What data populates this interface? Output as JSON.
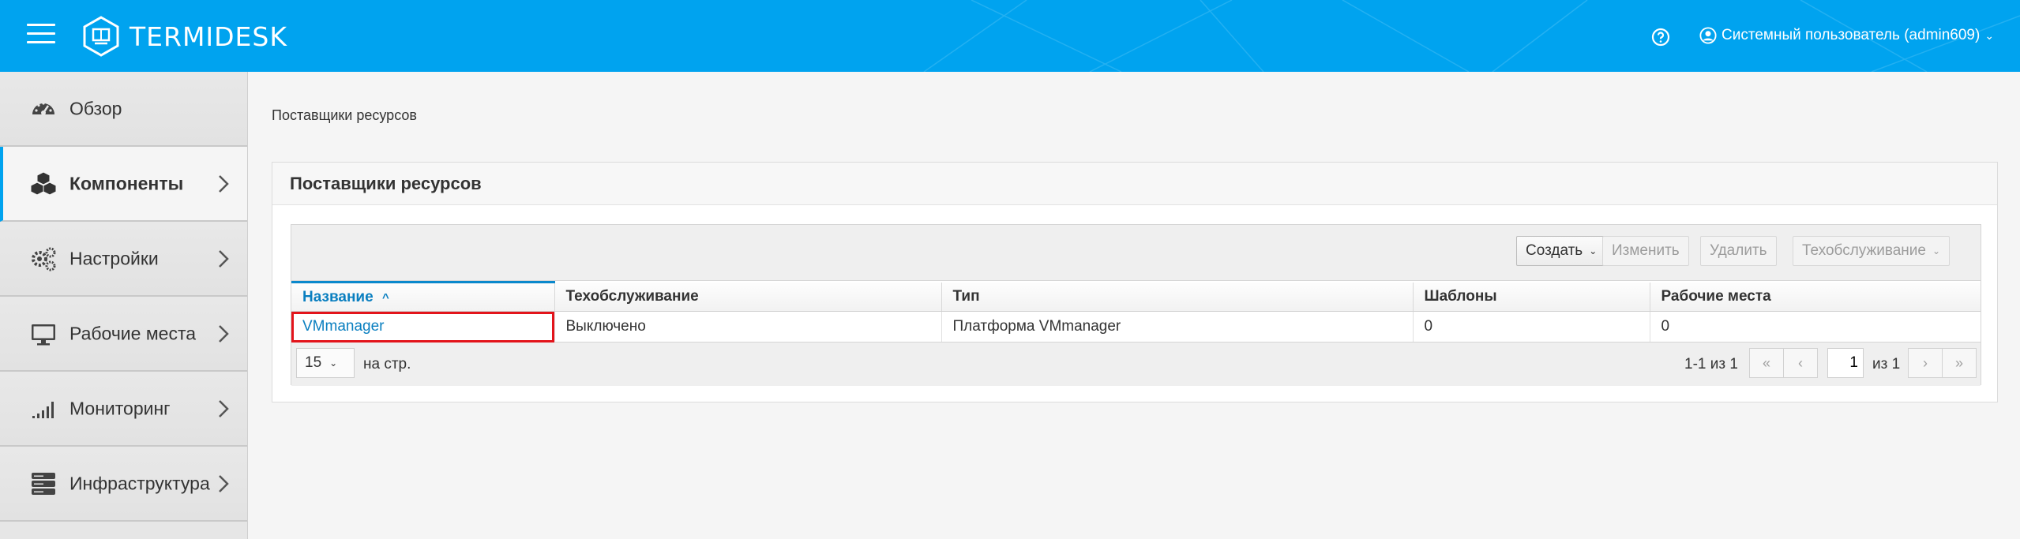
{
  "header": {
    "logo_text": "TERMIDESK",
    "user_label": "Системный пользователь (admin609)",
    "help_icon": "question-circle-icon",
    "user_icon": "user-circle-icon"
  },
  "colors": {
    "header_bg": "#00a3ef",
    "accent": "#0a7fc0",
    "highlight": "#e3141b"
  },
  "sidebar": {
    "items": [
      {
        "label": "Обзор",
        "icon": "dashboard-icon",
        "active": false
      },
      {
        "label": "Компоненты",
        "icon": "cubes-icon",
        "active": true
      },
      {
        "label": "Настройки",
        "icon": "gears-icon",
        "active": false
      },
      {
        "label": "Рабочие места",
        "icon": "desktop-icon",
        "active": false
      },
      {
        "label": "Мониторинг",
        "icon": "signal-bars-icon",
        "active": false
      },
      {
        "label": "Инфраструктура",
        "icon": "server-stack-icon",
        "active": false
      }
    ]
  },
  "breadcrumb": "Поставщики ресурсов",
  "panel": {
    "title": "Поставщики ресурсов"
  },
  "toolbar": {
    "create": "Создать",
    "edit": "Изменить",
    "delete": "Удалить",
    "maintenance": "Техобслуживание"
  },
  "table": {
    "columns": [
      "Название",
      "Техобслуживание",
      "Тип",
      "Шаблоны",
      "Рабочие места"
    ],
    "sort_indicator": "^",
    "rows": [
      [
        "VMmanager",
        "Выключено",
        "Платформа VMmanager",
        "0",
        "0"
      ]
    ]
  },
  "pager": {
    "per_page": "15",
    "per_page_label": "на стр.",
    "range": "1-1 из 1",
    "current_page": "1",
    "of_label": "из 1"
  }
}
